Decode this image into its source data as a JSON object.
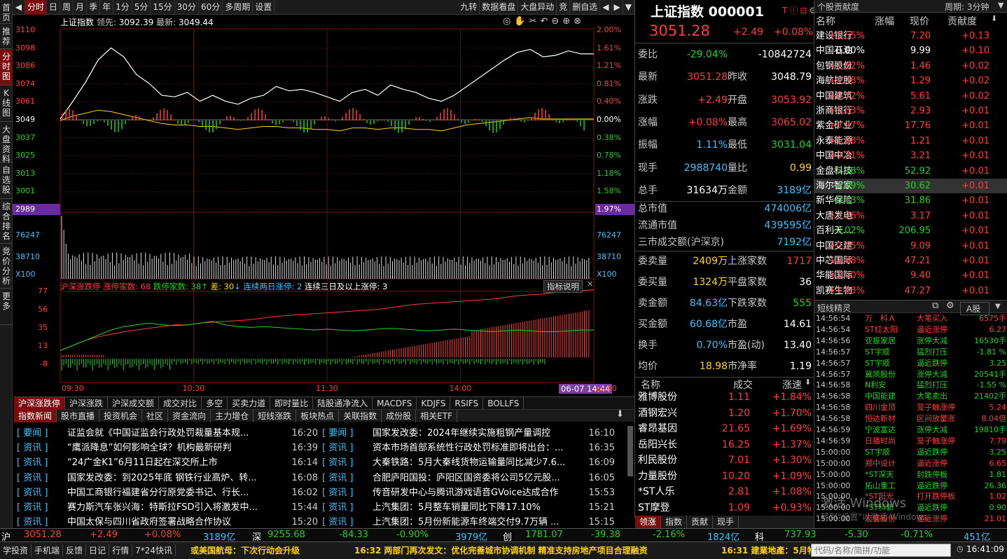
{
  "left_nav": [
    "首页",
    "推荐",
    "分时图",
    "K线图",
    "大盘资料",
    "自选股",
    "综合排名",
    "竞价分析",
    "更多"
  ],
  "toolbar": {
    "items": [
      "分时",
      "日",
      "周",
      "月",
      "季",
      "年",
      "1分",
      "5分",
      "15分",
      "30分",
      "60分",
      "多周期",
      "设置"
    ],
    "right_items": [
      "九转",
      "数据看盘",
      "大盘异动",
      "竞",
      "删自选"
    ]
  },
  "chart": {
    "title": "上证指数",
    "lead_label": "领先:",
    "lead_value": "3092.39",
    "latest_label": "最新:",
    "latest_value": "3049.44",
    "price_ticks": [
      "3110",
      "3098",
      "3086",
      "3074",
      "3061",
      "3049",
      "3037",
      "3025",
      "3013",
      "3001",
      "2989"
    ],
    "pct_ticks": [
      "2.00%",
      "1.61%",
      "1.21%",
      "0.81%",
      "0.40%",
      "0.00%",
      "0.38%",
      "0.78%",
      "1.18%",
      "1.58%",
      "1.97%"
    ],
    "vol_ticks": [
      "76247",
      "38710",
      "X100"
    ],
    "vol_ticks_right": [
      "76247",
      "38710",
      "X100"
    ],
    "time_ticks": [
      "09:30",
      "10:30",
      "11:30",
      "14:00",
      "15:00"
    ],
    "cursor_time": "06-07 14:44",
    "limit_title": "沪深涨跌停",
    "limit_up_label": "涨停家数:",
    "limit_up_value": "68",
    "limit_down_label": "跌停家数:",
    "limit_down_value": "38",
    "diff_label": "差:",
    "diff_value": "30",
    "two_day_label": "连续两日涨停:",
    "two_day_value": "2",
    "three_day_label": "连续三日及以上涨停:",
    "three_day_value": "3",
    "indicator_desc": "指标说明",
    "limit_ticks": [
      "77",
      "56",
      "35",
      "13",
      "-8"
    ],
    "chart_data": {
      "type": "line",
      "series": [
        {
          "name": "上证指数",
          "values": [
            3050,
            3062,
            3075,
            3090,
            3098,
            3092,
            3080,
            3074,
            3066,
            3065,
            3068,
            3062,
            3066,
            3062,
            3060,
            3064,
            3066,
            3072,
            3069,
            3070,
            3068,
            3065,
            3062,
            3068,
            3070,
            3066,
            3073,
            3070,
            3068,
            3064,
            3062,
            3066,
            3072,
            3078,
            3084,
            3090,
            3095,
            3097,
            3092,
            3093,
            3096,
            3094,
            3094
          ]
        },
        {
          "name": "均价",
          "values": [
            3049,
            3052,
            3054,
            3056,
            3055,
            3053,
            3051,
            3049,
            3047,
            3046,
            3046,
            3045,
            3045,
            3044,
            3043,
            3044,
            3045,
            3045,
            3044,
            3044,
            3043,
            3043,
            3042,
            3044,
            3044,
            3043,
            3044,
            3044,
            3043,
            3043,
            3042,
            3044,
            3046,
            3047,
            3048,
            3049,
            3050,
            3051,
            3050,
            3050,
            3050,
            3050,
            3050
          ]
        },
        {
          "name": "涨停家数",
          "values": [
            8,
            14,
            20,
            24,
            27,
            30,
            32,
            34,
            36,
            38,
            38,
            40,
            41,
            42,
            43,
            44,
            46,
            48,
            49,
            50,
            51,
            52,
            53,
            54,
            55,
            56,
            58,
            60,
            62,
            63,
            64,
            65,
            66,
            67,
            68,
            70,
            72,
            73,
            74,
            76,
            77,
            78,
            79
          ]
        },
        {
          "name": "跌停家数",
          "values": [
            8,
            14,
            20,
            26,
            32,
            36,
            38,
            40,
            38,
            37,
            38,
            40,
            42,
            38,
            36,
            35,
            36,
            35,
            34,
            33,
            32,
            33,
            32,
            31,
            32,
            33,
            34,
            33,
            32,
            31,
            32,
            33,
            32,
            31,
            30,
            31,
            32,
            31,
            30,
            30,
            31,
            32,
            32
          ]
        }
      ]
    }
  },
  "bottom_tabs": [
    "沪深涨跌停",
    "沪深涨跌",
    "沪深成交额",
    "成交对比",
    "多空",
    "买卖力道",
    "即时量比",
    "陆股通净流入",
    "MACDFS",
    "KDJFS",
    "RSIFS",
    "BOLLFS"
  ],
  "news_tabs": [
    "指数新闻",
    "股市直播",
    "投资机会",
    "社区",
    "资金流向",
    "主力增仓",
    "短线涨跌",
    "板块热点",
    "关联指数",
    "成份股",
    "相关ETF"
  ],
  "news_left": [
    {
      "tag": "要闻",
      "title": "证监会就《中国证监会行政处罚裁量基本规...",
      "time": "16:20"
    },
    {
      "tag": "资讯",
      "title": "“鹰派降息”如何影响全球？机构最新研判",
      "time": "16:39"
    },
    {
      "tag": "资讯",
      "title": "“24广金K1”6月11日起在深交所上市",
      "time": "16:14"
    },
    {
      "tag": "资讯",
      "title": "国家发改委：到2025年底 钢铁行业高炉、转...",
      "time": "16:08"
    },
    {
      "tag": "资讯",
      "title": "中国工商银行福建省分行原党委书记、行长...",
      "time": "16:02"
    },
    {
      "tag": "资讯",
      "title": "赛力斯汽车张兴海：特斯拉FSD引入将激发中...",
      "time": "15:44"
    },
    {
      "tag": "资讯",
      "title": "中国太保与四川省政府签署战略合作协议",
      "time": "15:20"
    }
  ],
  "news_right": [
    {
      "tag": "要闻",
      "title": "国家发改委：2024年继续实施粗钢产量调控",
      "time": "16:10"
    },
    {
      "tag": "资讯",
      "title": "资本市场首部系统性行政处罚标准即将出台：...",
      "time": "16:35"
    },
    {
      "tag": "资讯",
      "title": "大秦铁路：5月大秦线货物运输量同比减少7.6...",
      "time": "16:09"
    },
    {
      "tag": "资讯",
      "title": "合肥庐阳国投：庐阳区国资委将公司5亿元股...",
      "time": "16:05"
    },
    {
      "tag": "资讯",
      "title": "传音研发中心与腾讯游戏语音GVoice达成合作",
      "time": "15:53"
    },
    {
      "tag": "资讯",
      "title": "上汽集团：5月整车销量同比下降17.10%",
      "time": "15:21"
    },
    {
      "tag": "资讯",
      "title": "上汽集团：5月份新能源车终端交付9.7万辆 ...",
      "time": "15:15"
    }
  ],
  "quote": {
    "name": "上证指数",
    "code": "000001",
    "price": "3051.28",
    "change": "+2.49",
    "change_pct": "+0.08%",
    "rows": [
      {
        "l": "委比",
        "lv": "-29.04%",
        "lc": "green",
        "r": "",
        "rv": "-10842724",
        "rc": "white"
      },
      {
        "l": "最新",
        "lv": "3051.28",
        "lc": "red",
        "r": "昨收",
        "rv": "3048.79",
        "rc": "white"
      },
      {
        "l": "涨跌",
        "lv": "+2.49",
        "lc": "red",
        "r": "开盘",
        "rv": "3053.92",
        "rc": "red"
      },
      {
        "l": "涨幅",
        "lv": "+0.08%",
        "lc": "red",
        "r": "最高",
        "rv": "3065.02",
        "rc": "red"
      },
      {
        "l": "振幅",
        "lv": "1.11%",
        "lc": "cyan",
        "r": "最低",
        "rv": "3031.04",
        "rc": "green"
      },
      {
        "l": "现手",
        "lv": "2988740",
        "lc": "cyan",
        "r": "量比",
        "rv": "0.99",
        "rc": "yellow"
      },
      {
        "l": "总手",
        "lv": "31634万",
        "lc": "white",
        "r": "金额",
        "rv": "3189亿",
        "rc": "cyan"
      }
    ],
    "mkt_value_label": "总市值",
    "mkt_value": "474006亿",
    "float_value_label": "流通市值",
    "float_value": "439595亿",
    "three_label": "三市成交额(沪深京)",
    "three_value": "7192亿",
    "rows2": [
      {
        "l": "委卖量",
        "lv": "2409万",
        "lc": "yellow",
        "r": "上涨家数",
        "rv": "1717",
        "rc": "red"
      },
      {
        "l": "委买量",
        "lv": "1324万",
        "lc": "yellow",
        "r": "平盘家数",
        "rv": "36",
        "rc": "white"
      },
      {
        "l": "卖金额",
        "lv": "84.63亿",
        "lc": "cyan",
        "r": "下跌家数",
        "rv": "555",
        "rc": "green"
      },
      {
        "l": "买金额",
        "lv": "60.68亿",
        "lc": "cyan",
        "r": "市盈",
        "rv": "14.61",
        "rc": "white"
      },
      {
        "l": "换手",
        "lv": "0.70%",
        "lc": "cyan",
        "r": "市盈(动)",
        "rv": "13.40",
        "rc": "white"
      },
      {
        "l": "均价",
        "lv": "18.98",
        "lc": "yellow",
        "r": "市净率",
        "rv": "1.19",
        "rc": "white"
      }
    ],
    "fast_headers": [
      "名称",
      "成交",
      "涨速"
    ],
    "fast": [
      {
        "n": "雅博股份",
        "p": "1.11",
        "s": "+1.84%"
      },
      {
        "n": "酒钢宏兴",
        "p": "1.20",
        "s": "+1.70%"
      },
      {
        "n": "睿昂基因",
        "p": "21.65",
        "s": "+1.69%"
      },
      {
        "n": "岳阳兴长",
        "p": "16.25",
        "s": "+1.37%"
      },
      {
        "n": "利民股份",
        "p": "7.01",
        "s": "+1.30%"
      },
      {
        "n": "力量股份",
        "p": "10.20",
        "s": "+1.09%"
      },
      {
        "n": "*ST人乐",
        "p": "2.81",
        "s": "+1.08%"
      },
      {
        "n": "ST摩登",
        "p": "1.09",
        "s": "+0.93%"
      }
    ],
    "fast_tabs": [
      "领涨",
      "指数",
      "贡献",
      "现手"
    ]
  },
  "contrib": {
    "title": "个股贡献度",
    "period": "周期: 3分钟",
    "headers": [
      "名称",
      "涨幅",
      "现价",
      "贡献度"
    ],
    "rows": [
      {
        "n": "建设银行",
        "pct": "+1.55%",
        "p": "7.20",
        "c": "+0.13"
      },
      {
        "n": "中国石油",
        "pct": "0.00%",
        "p": "9.99",
        "c": "+0.10"
      },
      {
        "n": "包钢股份",
        "pct": "+2.82%",
        "p": "1.46",
        "c": "+0.02"
      },
      {
        "n": "海航控股",
        "pct": "+2.38%",
        "p": "1.29",
        "c": "+0.02"
      },
      {
        "n": "中国建筑",
        "pct": "+0.72%",
        "p": "5.61",
        "c": "+0.02"
      },
      {
        "n": "浙商银行",
        "pct": "+1.03%",
        "p": "2.93",
        "c": "+0.01"
      },
      {
        "n": "紫金矿业",
        "pct": "+0.97%",
        "p": "17.76",
        "c": "+0.01"
      },
      {
        "n": "永泰能源",
        "pct": "+1.68%",
        "p": "1.21",
        "c": "+0.01"
      },
      {
        "n": "中国中冶",
        "pct": "+0.31%",
        "p": "3.21",
        "c": "+0.01"
      },
      {
        "n": "金盘科技",
        "pct": "-5.18%",
        "p": "52.92",
        "c": "+0.01"
      },
      {
        "n": "海尔智家",
        "pct": "-1.19%",
        "p": "30.62",
        "c": "+0.01"
      },
      {
        "n": "新华保险",
        "pct": "-0.13%",
        "p": "31.86",
        "c": "+0.01"
      },
      {
        "n": "大唐发电",
        "pct": "+3.26%",
        "p": "3.17",
        "c": "+0.01"
      },
      {
        "n": "百利天...",
        "pct": "-0.02%",
        "p": "206.95",
        "c": "+0.01"
      },
      {
        "n": "中国交建",
        "pct": "+0.55%",
        "p": "9.09",
        "c": "+0.01"
      },
      {
        "n": "中芯国际",
        "pct": "+0.88%",
        "p": "47.21",
        "c": "+0.01"
      },
      {
        "n": "华能国际",
        "pct": "+1.40%",
        "p": "9.40",
        "c": "+0.01"
      },
      {
        "n": "凯赛生物",
        "pct": "+1.03%",
        "p": "47.27",
        "c": "+0.01"
      }
    ]
  },
  "shortline": {
    "title": "短线精灵",
    "market": "A股",
    "rows": [
      {
        "t": "14:56:54",
        "n": "万　科Ａ",
        "e": "大笔买入",
        "v": "6575手",
        "c": "red"
      },
      {
        "t": "14:56:54",
        "n": "ST红太阳",
        "e": "逼近涨停",
        "v": "6.27",
        "c": "red"
      },
      {
        "t": "14:56:56",
        "n": "亚振家居",
        "e": "涨停大减",
        "v": "16530手",
        "c": "green"
      },
      {
        "t": "14:56:57",
        "n": "ST宇顺",
        "e": "猛烈打压",
        "v": "-1.81 %",
        "c": "green"
      },
      {
        "t": "14:56:57",
        "n": "ST宇顺",
        "e": "逼近跌停",
        "v": "3.25",
        "c": "green"
      },
      {
        "t": "14:56:57",
        "n": "冀凯股份",
        "e": "涨停大减",
        "v": "20541手",
        "c": "green"
      },
      {
        "t": "14:56:58",
        "n": "N利安",
        "e": "猛烈打压",
        "v": "-1.55 %",
        "c": "green"
      },
      {
        "t": "14:56:58",
        "n": "中国能建",
        "e": "大笔卖出",
        "v": "21402手",
        "c": "green"
      },
      {
        "t": "14:56:58",
        "n": "四川金顶",
        "e": "笼子触涨停",
        "v": "5.24",
        "c": "red"
      },
      {
        "t": "14:56:58",
        "n": "恒达新材",
        "e": "区间放量涨",
        "v": "8.04倍",
        "c": "red"
      },
      {
        "t": "14:56:59",
        "n": "宁波富达",
        "e": "涨停大减",
        "v": "19810手",
        "c": "green"
      },
      {
        "t": "14:56:59",
        "n": "日播时尚",
        "e": "笼子触涨停",
        "v": "7.79",
        "c": "red"
      },
      {
        "t": "15:00:00",
        "n": "ST宇顺",
        "e": "逼近跌停",
        "v": "3.25",
        "c": "green"
      },
      {
        "t": "15:00:00",
        "n": "郑中设计",
        "e": "逼近涨停",
        "v": "6.65",
        "c": "red"
      },
      {
        "t": "15:00:00",
        "n": "*ST深天",
        "e": "封跌停板",
        "v": "1.81",
        "c": "green"
      },
      {
        "t": "15:00:00",
        "n": "拓山重工",
        "e": "逼近跌停",
        "v": "26.36",
        "c": "green"
      },
      {
        "t": "15:00:00",
        "n": "*ST阳光",
        "e": "打开跌停板",
        "v": "1.02",
        "c": "red"
      },
      {
        "t": "15:00:00",
        "n": "*ST科新",
        "e": "逼近跌停",
        "v": "0.90",
        "c": "green"
      },
      {
        "t": "15:00:00",
        "n": "宏盛股份",
        "e": "逼近涨停",
        "v": "21.01",
        "c": "red"
      }
    ]
  },
  "status_bar": {
    "sh_label": "沪",
    "sh_price": "3051.28",
    "sh_chg": "+2.49",
    "sh_pct": "+0.08%",
    "sh_amt": "3189亿",
    "sz_label": "深",
    "sz_price": "9255.68",
    "sz_chg": "-84.33",
    "sz_pct": "-0.90%",
    "sz_amt": "3979亿",
    "cy_label": "创",
    "cy_price": "1781.07",
    "cy_chg": "-39.38",
    "cy_pct": "-2.16%",
    "cy_amt": "1824亿",
    "kc_label": "科",
    "kc_price": "737.93",
    "kc_chg": "-5.30",
    "kc_pct": "-0.71%",
    "kc_amt": "451亿"
  },
  "bottom_bar": {
    "items": [
      "学投资",
      "手机端",
      "反馈",
      "日记",
      "行情",
      "7*24快讯"
    ],
    "ticker1": "或美国航母：下次行动会升级",
    "ticker2": "16:32 两部门再次发文：优化完善城市协调机制 精准支持房地产项目合理融资",
    "ticker3": "16:31 建業地產：5月物",
    "search_placeholder": "代码/名称/简拼/功能",
    "clock": "16:41:09"
  },
  "watermark": {
    "line1": "激活 Windows",
    "line2": "转到\"设置\"以激活 Windows。"
  }
}
